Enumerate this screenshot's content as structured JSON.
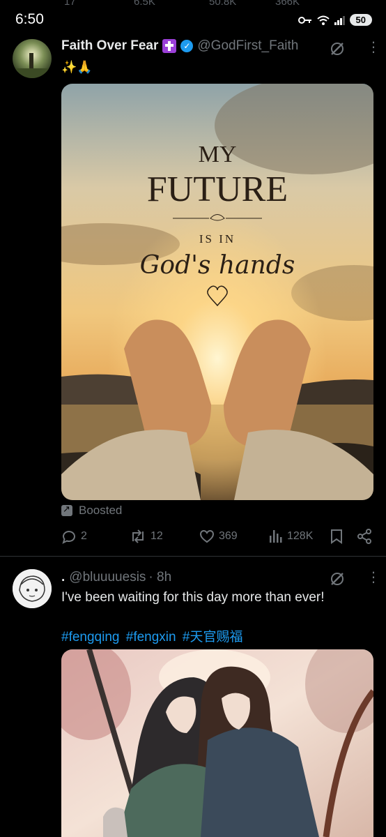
{
  "status_bar": {
    "time": "6:50",
    "battery": "50",
    "ghost_counts": [
      "17",
      "6.5K",
      "50.8K",
      "366K"
    ]
  },
  "post1": {
    "display_name": "Faith Over Fear",
    "handle": "@GodFirst_Faith",
    "bio": "✨🙏",
    "image_text": {
      "line1": "MY",
      "line2": "FUTURE",
      "line3": "IS IN",
      "line4": "God's hands"
    },
    "boosted_label": "Boosted",
    "actions": {
      "replies": "2",
      "reposts": "12",
      "likes": "369",
      "views": "128K"
    }
  },
  "post2": {
    "display_name": ".",
    "handle": "@bluuuuesis",
    "time": "· 8h",
    "text": "I've been waiting for this day more than ever!",
    "hashtags": [
      "#fengqing",
      "#fengxin",
      "#天官赐福"
    ]
  },
  "colors": {
    "background": "#000000",
    "text": "#e7e9ea",
    "muted": "#71767b",
    "accent": "#1d9bf0",
    "divider": "#2f3336"
  }
}
